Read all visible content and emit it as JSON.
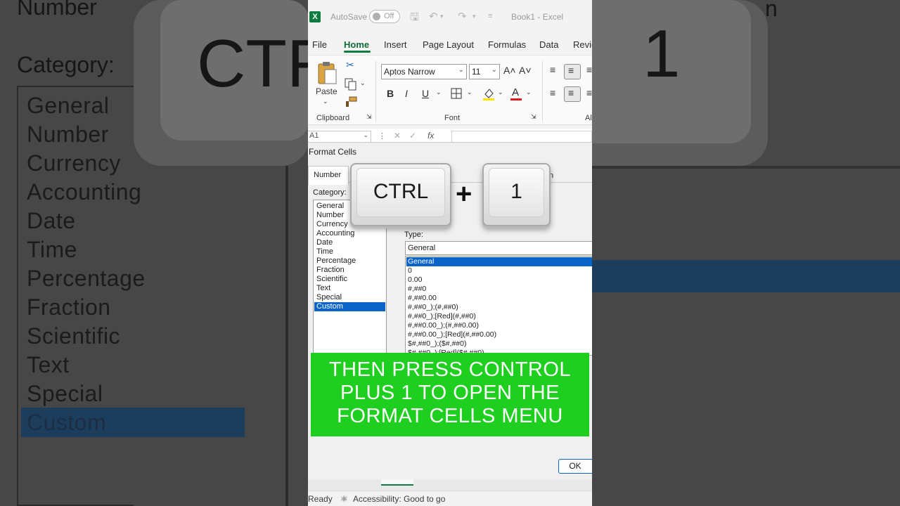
{
  "background": {
    "left_heading": "Number",
    "left_category_label": "Category:",
    "left_categories": [
      "General",
      "Number",
      "Currency",
      "Accounting",
      "Date",
      "Time",
      "Percentage",
      "Fraction",
      "Scientific",
      "Text",
      "Special",
      "Custom"
    ],
    "left_key_fragment": "CTF",
    "right_key_label": "1",
    "right_heading_fragment": "n"
  },
  "titlebar": {
    "autosave_label": "AutoSave",
    "autosave_state": "Off",
    "workbook_title": "Book1  -  Excel"
  },
  "menu": {
    "tabs": [
      "File",
      "Home",
      "Insert",
      "Page Layout",
      "Formulas",
      "Data",
      "Revie"
    ],
    "active_tab": "Home"
  },
  "ribbon": {
    "clipboard_group": "Clipboard",
    "paste_label": "Paste",
    "font_group": "Font",
    "alignment_group_fragment": "Al",
    "font_name": "Aptos Narrow",
    "font_size": "11",
    "bold": "B",
    "italic": "I",
    "underline": "U",
    "grow_font": "A˄",
    "shrink_font": "A˅",
    "font_color": "A"
  },
  "formula_bar": {
    "name_box": "A1",
    "fx": "fx"
  },
  "dialog": {
    "title": "Format Cells",
    "tabs": [
      "Number",
      "n"
    ],
    "category_label": "Category:",
    "categories": [
      "General",
      "Number",
      "Currency",
      "Accounting",
      "Date",
      "Time",
      "Percentage",
      "Fraction",
      "Scientific",
      "Text",
      "Special",
      "Custom"
    ],
    "selected_category": "Custom",
    "type_label": "Type:",
    "type_value": "General",
    "type_list": [
      "General",
      "0",
      "0.00",
      "#,##0",
      "#,##0.00",
      "#,##0_);(#,##0)",
      "#,##0_);[Red](#,##0)",
      "#,##0.00_);(#,##0.00)",
      "#,##0.00_);[Red](#,##0.00)",
      "$#,##0_);($#,##0)",
      "$#,##0_);[Red]($#,##0)"
    ],
    "selected_type": "General",
    "ok_label": "OK"
  },
  "status": {
    "ready": "Ready",
    "accessibility": "Accessibility: Good to go"
  },
  "overlay": {
    "key1": "CTRL",
    "plus": "+",
    "key2": "1",
    "caption_lines": [
      "THEN PRESS CONTROL",
      "PLUS 1 TO OPEN THE",
      "FORMAT CELLS MENU"
    ]
  },
  "colors": {
    "excel_green": "#107c41",
    "caption_green": "#1fcf1f",
    "selection_blue": "#0a64c7"
  },
  "icons": [
    "excel-logo-icon",
    "save-icon",
    "undo-icon",
    "redo-icon",
    "paste-icon",
    "cut-icon",
    "copy-icon",
    "format-painter-icon",
    "border-icon",
    "fill-color-icon",
    "accessibility-icon"
  ]
}
